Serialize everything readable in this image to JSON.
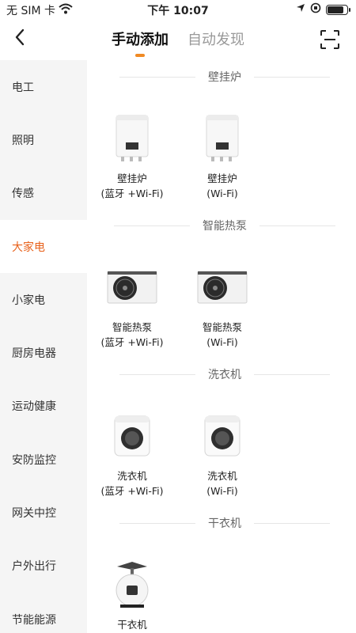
{
  "status_bar": {
    "carrier": "无 SIM 卡",
    "time": "下午 10:07"
  },
  "header": {
    "tabs": [
      {
        "label": "手动添加",
        "active": true
      },
      {
        "label": "自动发现",
        "active": false
      }
    ]
  },
  "sidebar": {
    "items": [
      {
        "label": "电工"
      },
      {
        "label": "照明"
      },
      {
        "label": "传感"
      },
      {
        "label": "大家电",
        "active": true
      },
      {
        "label": "小家电"
      },
      {
        "label": "厨房电器"
      },
      {
        "label": "运动健康"
      },
      {
        "label": "安防监控"
      },
      {
        "label": "网关中控"
      },
      {
        "label": "户外出行"
      },
      {
        "label": "节能能源"
      }
    ]
  },
  "sections": [
    {
      "title": "壁挂炉",
      "devices": [
        {
          "name": "壁挂炉",
          "sub": "(蓝牙 +Wi-Fi)",
          "icon": "boiler-icon"
        },
        {
          "name": "壁挂炉",
          "sub": "(Wi-Fi)",
          "icon": "boiler-icon"
        }
      ]
    },
    {
      "title": "智能热泵",
      "devices": [
        {
          "name": "智能热泵",
          "sub": "(蓝牙 +Wi-Fi)",
          "icon": "heat-pump-icon"
        },
        {
          "name": "智能热泵",
          "sub": "(Wi-Fi)",
          "icon": "heat-pump-icon"
        }
      ]
    },
    {
      "title": "洗衣机",
      "devices": [
        {
          "name": "洗衣机",
          "sub": "(蓝牙 +Wi-Fi)",
          "icon": "washer-icon"
        },
        {
          "name": "洗衣机",
          "sub": "(Wi-Fi)",
          "icon": "washer-icon"
        }
      ]
    },
    {
      "title": "干衣机",
      "devices": [
        {
          "name": "干衣机",
          "sub": "",
          "icon": "dryer-icon"
        }
      ]
    }
  ],
  "colors": {
    "accent": "#e8621c",
    "indicator": "#f08a24",
    "sidebar_bg": "#f5f5f5"
  }
}
